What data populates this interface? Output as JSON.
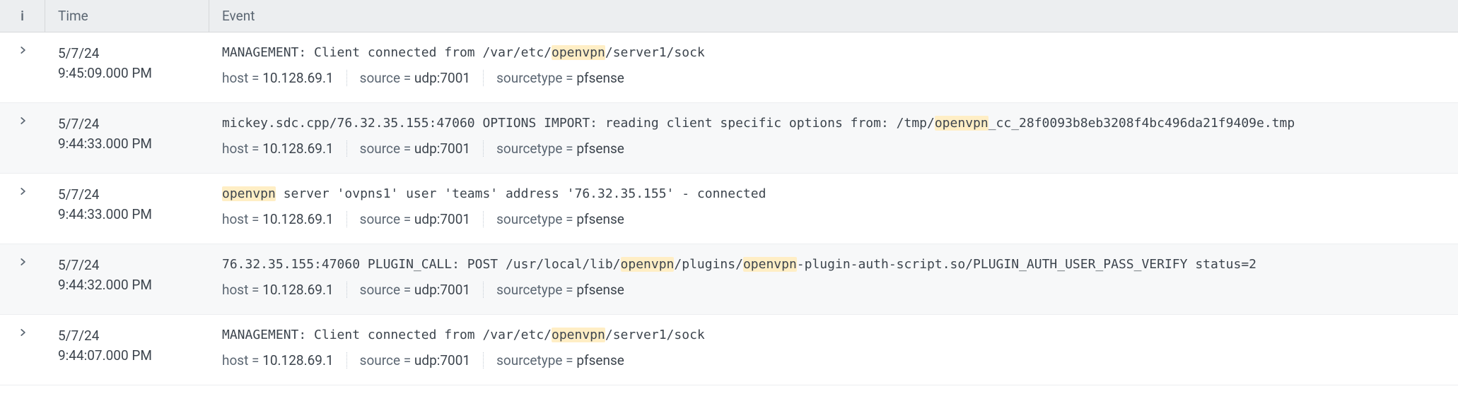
{
  "highlight_term": "openvpn",
  "header": {
    "info": "i",
    "time": "Time",
    "event": "Event"
  },
  "meta_labels": {
    "host": "host",
    "source": "source",
    "sourcetype": "sourcetype"
  },
  "events": [
    {
      "date": "5/7/24",
      "time": "9:45:09.000 PM",
      "raw": "MANAGEMENT: Client connected from /var/etc/openvpn/server1/sock",
      "host": "10.128.69.1",
      "source": "udp:7001",
      "sourcetype": "pfsense"
    },
    {
      "date": "5/7/24",
      "time": "9:44:33.000 PM",
      "raw": "mickey.sdc.cpp/76.32.35.155:47060 OPTIONS IMPORT: reading client specific options from: /tmp/openvpn_cc_28f0093b8eb3208f4bc496da21f9409e.tmp",
      "host": "10.128.69.1",
      "source": "udp:7001",
      "sourcetype": "pfsense"
    },
    {
      "date": "5/7/24",
      "time": "9:44:33.000 PM",
      "raw": "openvpn server 'ovpns1' user 'teams' address '76.32.35.155' - connected",
      "host": "10.128.69.1",
      "source": "udp:7001",
      "sourcetype": "pfsense"
    },
    {
      "date": "5/7/24",
      "time": "9:44:32.000 PM",
      "raw": "76.32.35.155:47060 PLUGIN_CALL: POST /usr/local/lib/openvpn/plugins/openvpn-plugin-auth-script.so/PLUGIN_AUTH_USER_PASS_VERIFY status=2",
      "host": "10.128.69.1",
      "source": "udp:7001",
      "sourcetype": "pfsense"
    },
    {
      "date": "5/7/24",
      "time": "9:44:07.000 PM",
      "raw": "MANAGEMENT: Client connected from /var/etc/openvpn/server1/sock",
      "host": "10.128.69.1",
      "source": "udp:7001",
      "sourcetype": "pfsense"
    }
  ]
}
